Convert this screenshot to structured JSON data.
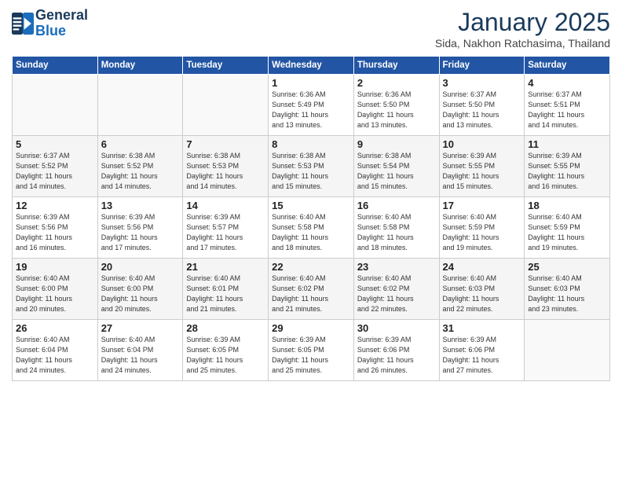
{
  "header": {
    "logo_line1": "General",
    "logo_line2": "Blue",
    "month": "January 2025",
    "location": "Sida, Nakhon Ratchasima, Thailand"
  },
  "days_of_week": [
    "Sunday",
    "Monday",
    "Tuesday",
    "Wednesday",
    "Thursday",
    "Friday",
    "Saturday"
  ],
  "weeks": [
    [
      {
        "day": "",
        "info": ""
      },
      {
        "day": "",
        "info": ""
      },
      {
        "day": "",
        "info": ""
      },
      {
        "day": "1",
        "info": "Sunrise: 6:36 AM\nSunset: 5:49 PM\nDaylight: 11 hours\nand 13 minutes."
      },
      {
        "day": "2",
        "info": "Sunrise: 6:36 AM\nSunset: 5:50 PM\nDaylight: 11 hours\nand 13 minutes."
      },
      {
        "day": "3",
        "info": "Sunrise: 6:37 AM\nSunset: 5:50 PM\nDaylight: 11 hours\nand 13 minutes."
      },
      {
        "day": "4",
        "info": "Sunrise: 6:37 AM\nSunset: 5:51 PM\nDaylight: 11 hours\nand 14 minutes."
      }
    ],
    [
      {
        "day": "5",
        "info": "Sunrise: 6:37 AM\nSunset: 5:52 PM\nDaylight: 11 hours\nand 14 minutes."
      },
      {
        "day": "6",
        "info": "Sunrise: 6:38 AM\nSunset: 5:52 PM\nDaylight: 11 hours\nand 14 minutes."
      },
      {
        "day": "7",
        "info": "Sunrise: 6:38 AM\nSunset: 5:53 PM\nDaylight: 11 hours\nand 14 minutes."
      },
      {
        "day": "8",
        "info": "Sunrise: 6:38 AM\nSunset: 5:53 PM\nDaylight: 11 hours\nand 15 minutes."
      },
      {
        "day": "9",
        "info": "Sunrise: 6:38 AM\nSunset: 5:54 PM\nDaylight: 11 hours\nand 15 minutes."
      },
      {
        "day": "10",
        "info": "Sunrise: 6:39 AM\nSunset: 5:55 PM\nDaylight: 11 hours\nand 15 minutes."
      },
      {
        "day": "11",
        "info": "Sunrise: 6:39 AM\nSunset: 5:55 PM\nDaylight: 11 hours\nand 16 minutes."
      }
    ],
    [
      {
        "day": "12",
        "info": "Sunrise: 6:39 AM\nSunset: 5:56 PM\nDaylight: 11 hours\nand 16 minutes."
      },
      {
        "day": "13",
        "info": "Sunrise: 6:39 AM\nSunset: 5:56 PM\nDaylight: 11 hours\nand 17 minutes."
      },
      {
        "day": "14",
        "info": "Sunrise: 6:39 AM\nSunset: 5:57 PM\nDaylight: 11 hours\nand 17 minutes."
      },
      {
        "day": "15",
        "info": "Sunrise: 6:40 AM\nSunset: 5:58 PM\nDaylight: 11 hours\nand 18 minutes."
      },
      {
        "day": "16",
        "info": "Sunrise: 6:40 AM\nSunset: 5:58 PM\nDaylight: 11 hours\nand 18 minutes."
      },
      {
        "day": "17",
        "info": "Sunrise: 6:40 AM\nSunset: 5:59 PM\nDaylight: 11 hours\nand 19 minutes."
      },
      {
        "day": "18",
        "info": "Sunrise: 6:40 AM\nSunset: 5:59 PM\nDaylight: 11 hours\nand 19 minutes."
      }
    ],
    [
      {
        "day": "19",
        "info": "Sunrise: 6:40 AM\nSunset: 6:00 PM\nDaylight: 11 hours\nand 20 minutes."
      },
      {
        "day": "20",
        "info": "Sunrise: 6:40 AM\nSunset: 6:00 PM\nDaylight: 11 hours\nand 20 minutes."
      },
      {
        "day": "21",
        "info": "Sunrise: 6:40 AM\nSunset: 6:01 PM\nDaylight: 11 hours\nand 21 minutes."
      },
      {
        "day": "22",
        "info": "Sunrise: 6:40 AM\nSunset: 6:02 PM\nDaylight: 11 hours\nand 21 minutes."
      },
      {
        "day": "23",
        "info": "Sunrise: 6:40 AM\nSunset: 6:02 PM\nDaylight: 11 hours\nand 22 minutes."
      },
      {
        "day": "24",
        "info": "Sunrise: 6:40 AM\nSunset: 6:03 PM\nDaylight: 11 hours\nand 22 minutes."
      },
      {
        "day": "25",
        "info": "Sunrise: 6:40 AM\nSunset: 6:03 PM\nDaylight: 11 hours\nand 23 minutes."
      }
    ],
    [
      {
        "day": "26",
        "info": "Sunrise: 6:40 AM\nSunset: 6:04 PM\nDaylight: 11 hours\nand 24 minutes."
      },
      {
        "day": "27",
        "info": "Sunrise: 6:40 AM\nSunset: 6:04 PM\nDaylight: 11 hours\nand 24 minutes."
      },
      {
        "day": "28",
        "info": "Sunrise: 6:39 AM\nSunset: 6:05 PM\nDaylight: 11 hours\nand 25 minutes."
      },
      {
        "day": "29",
        "info": "Sunrise: 6:39 AM\nSunset: 6:05 PM\nDaylight: 11 hours\nand 25 minutes."
      },
      {
        "day": "30",
        "info": "Sunrise: 6:39 AM\nSunset: 6:06 PM\nDaylight: 11 hours\nand 26 minutes."
      },
      {
        "day": "31",
        "info": "Sunrise: 6:39 AM\nSunset: 6:06 PM\nDaylight: 11 hours\nand 27 minutes."
      },
      {
        "day": "",
        "info": ""
      }
    ]
  ]
}
